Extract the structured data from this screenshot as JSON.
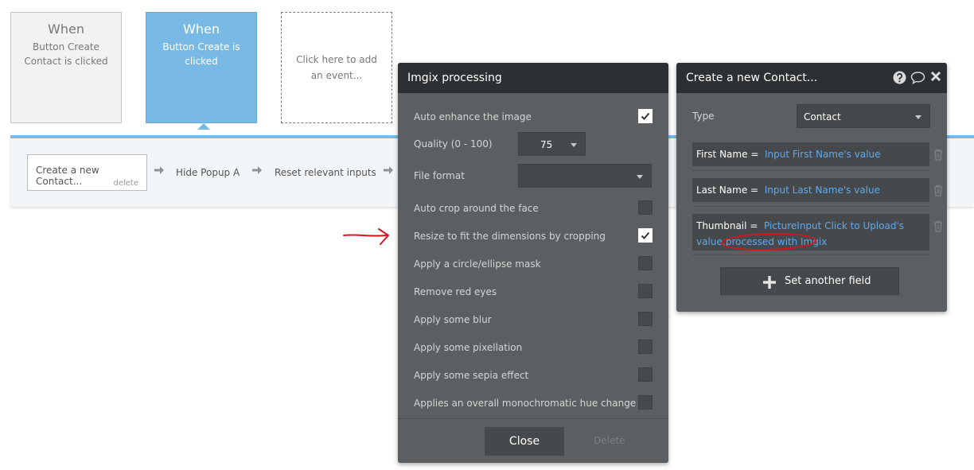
{
  "events": [
    {
      "when": "When",
      "desc": "Button Create Contact is clicked"
    },
    {
      "when": "When",
      "desc": "Button Create is clicked"
    }
  ],
  "add_event": "Click here to add an event...",
  "actions": {
    "first": {
      "label": "Create a new Contact...",
      "delete": "delete"
    },
    "second": "Hide Popup A",
    "third": "Reset relevant inputs"
  },
  "imgix": {
    "title": "Imgix processing",
    "options": [
      {
        "label": "Auto enhance the image",
        "checked": true
      },
      {
        "label": "Auto crop around the face",
        "checked": false
      },
      {
        "label": "Resize to fit the dimensions by cropping",
        "checked": true
      },
      {
        "label": "Apply a circle/ellipse mask",
        "checked": false
      },
      {
        "label": "Remove red eyes",
        "checked": false
      },
      {
        "label": "Apply some blur",
        "checked": false
      },
      {
        "label": "Apply some pixellation",
        "checked": false
      },
      {
        "label": "Apply some sepia effect",
        "checked": false
      },
      {
        "label": "Applies an overall monochromatic hue change",
        "checked": false
      }
    ],
    "quality_label": "Quality (0 - 100)",
    "quality_value": "75",
    "format_label": "File format",
    "format_value": "",
    "close_label": "Close",
    "delete_label": "Delete"
  },
  "contact": {
    "title": "Create a new Contact...",
    "type_label": "Type",
    "type_value": "Contact",
    "fields": [
      {
        "key": "First Name",
        "eq": "=",
        "value": "Input First Name's value"
      },
      {
        "key": "Last Name",
        "eq": "=",
        "value": "Input Last Name's value"
      },
      {
        "key": "Thumbnail",
        "eq": "=",
        "value": "PictureInput Click to Upload's value:processed with Imgix"
      }
    ],
    "set_another": "Set another field"
  },
  "colors": {
    "accent": "#78b9e6",
    "panel": "#5b5f61",
    "panel_header": "#2c3033",
    "link": "#5ea9f0",
    "annotation": "#d8141e"
  }
}
